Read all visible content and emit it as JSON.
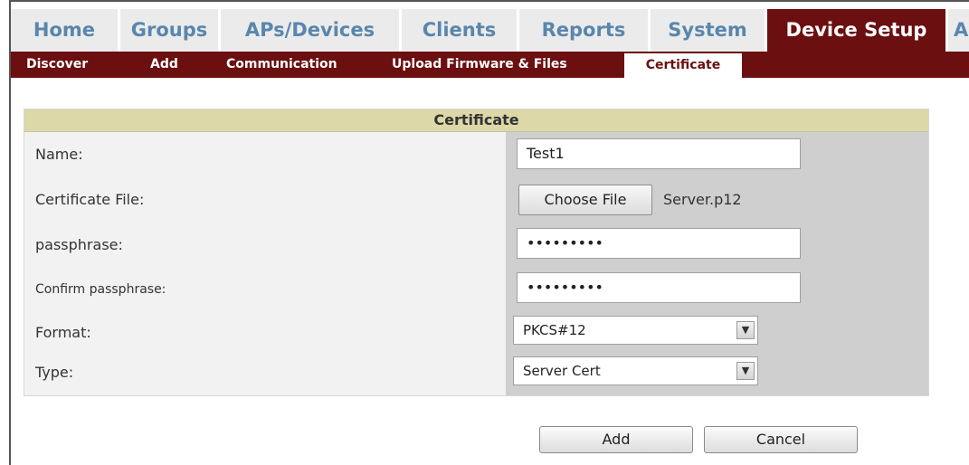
{
  "main_nav": {
    "tabs": [
      {
        "label": "Home"
      },
      {
        "label": "Groups"
      },
      {
        "label": "APs/Devices"
      },
      {
        "label": "Clients"
      },
      {
        "label": "Reports"
      },
      {
        "label": "System"
      },
      {
        "label": "Device Setup",
        "active": true
      },
      {
        "label": "A"
      }
    ]
  },
  "sub_nav": {
    "tabs": [
      {
        "label": "Discover"
      },
      {
        "label": "Add"
      },
      {
        "label": "Communication"
      },
      {
        "label": "Upload Firmware & Files"
      },
      {
        "label": "Certificate",
        "active": true
      }
    ]
  },
  "form": {
    "title": "Certificate",
    "name_label": "Name:",
    "name_value": "Test1",
    "file_label": "Certificate File:",
    "choose_file_label": "Choose File",
    "file_name": "Server.p12",
    "passphrase_label": "passphrase:",
    "passphrase_value": "•••••••••",
    "confirm_label": "Confirm passphrase:",
    "confirm_value": "•••••••••",
    "format_label": "Format:",
    "format_value": "PKCS#12",
    "type_label": "Type:",
    "type_value": "Server Cert"
  },
  "actions": {
    "add_label": "Add",
    "cancel_label": "Cancel"
  },
  "colors": {
    "brand_dark_red": "#6b0f10",
    "tab_text_blue": "#5a86ad",
    "header_khaki": "#dcd8a8"
  },
  "icons": {
    "dropdown": "chevron-down-icon"
  }
}
